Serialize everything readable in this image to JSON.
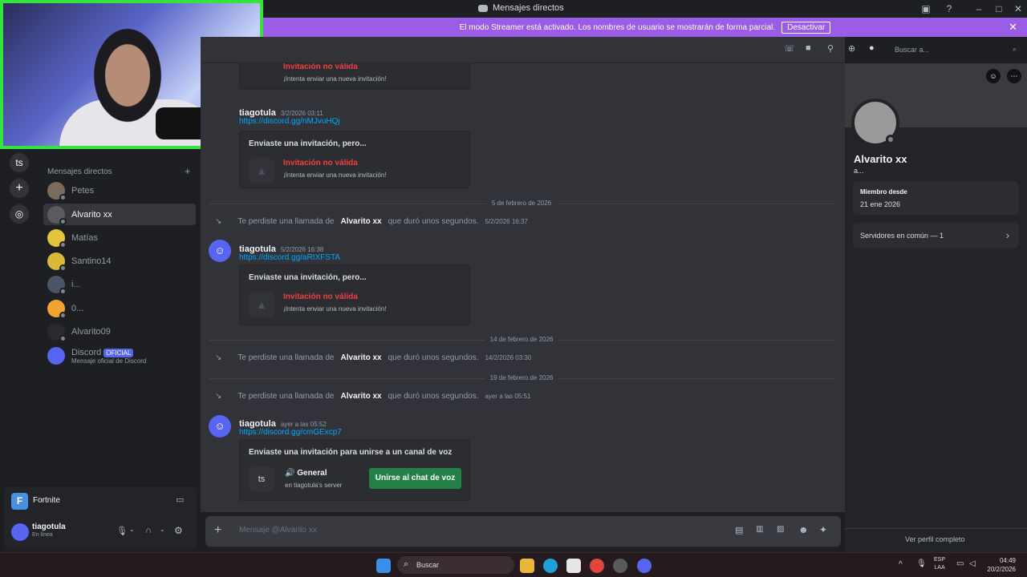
{
  "window": {
    "title": "Mensajes directos"
  },
  "streamer_banner": {
    "text": "El modo Streamer está activado. Los nombres de usuario se mostrarán de forma parcial.",
    "button": "Desactivar"
  },
  "rail": {
    "ts": "ts"
  },
  "dm_header": "Mensajes directos",
  "dms": [
    {
      "name": "Petes",
      "sub": ""
    },
    {
      "name": "Alvarito xx",
      "sub": ""
    },
    {
      "name": "Matías",
      "sub": ""
    },
    {
      "name": "Santino14",
      "sub": ""
    },
    {
      "name": "i...",
      "sub": ""
    },
    {
      "name": "0...",
      "sub": ""
    },
    {
      "name": "Alvarito09",
      "sub": ""
    },
    {
      "name": "Discord",
      "sub": "Mensaje oficial de Discord",
      "badge": "OFICIAL"
    }
  ],
  "activity": {
    "game": "Fortnite"
  },
  "user": {
    "name": "tiagotula",
    "status": "En línea"
  },
  "header": {
    "search_placeholder": "Buscar a..."
  },
  "chat": {
    "top_invite": {
      "invalid": "Invitación no válida",
      "retry": "¡Intenta enviar una nueva invitación!"
    },
    "msg1": {
      "author": "tiagotula",
      "time": "3/2/2026 03:11",
      "link": "https://discord.gg/nMJvuHQj",
      "invite_title": "Enviaste una invitación, pero...",
      "invalid": "Invitación no válida",
      "retry": "¡Intenta enviar una nueva invitación!"
    },
    "date1": "5 de febrero de 2026",
    "call1": {
      "pre": "Te perdiste una llamada de",
      "name": "Alvarito xx",
      "post": "que duró unos segundos.",
      "time": "5/2/2026 16:37"
    },
    "msg2": {
      "author": "tiagotula",
      "time": "5/2/2026 16:38",
      "link": "https://discord.gg/aRtXFSTA",
      "invite_title": "Enviaste una invitación, pero...",
      "invalid": "Invitación no válida",
      "retry": "¡Intenta enviar una nueva invitación!"
    },
    "date2": "14 de febrero de 2026",
    "call2": {
      "pre": "Te perdiste una llamada de",
      "name": "Alvarito xx",
      "post": "que duró unos segundos.",
      "time": "14/2/2026 03:30"
    },
    "date3": "19 de febrero de 2026",
    "call3": {
      "pre": "Te perdiste una llamada de",
      "name": "Alvarito xx",
      "post": "que duró unos segundos.",
      "time": "ayer a las 05:51"
    },
    "msg3": {
      "author": "tiagotula",
      "time": "ayer a las 05:52",
      "link": "https://discord.gg/cmGExcp7",
      "invite_title": "Enviaste una invitación para unirse a un canal de voz",
      "server_icon": "ts",
      "channel": "General",
      "server": "en tiagotula's server",
      "join": "Unirse al chat de voz"
    },
    "composer_placeholder": "Mensaje @Alvarito xx"
  },
  "profile": {
    "name": "Alvarito xx",
    "username": "a...",
    "member_since_label": "Miembro desde",
    "member_since": "21 ene 2026",
    "mutual": "Servidores en común — 1",
    "full_profile": "Ver perfil completo"
  },
  "taskbar": {
    "search": "Buscar",
    "lang1": "ESP",
    "lang2": "LAA",
    "time": "04:49",
    "date": "20/2/2026"
  },
  "colors": {
    "accent": "#5865f2",
    "streamer": "#9b5de5",
    "green": "#248046",
    "error": "#f23f43",
    "link": "#00a8fc"
  }
}
